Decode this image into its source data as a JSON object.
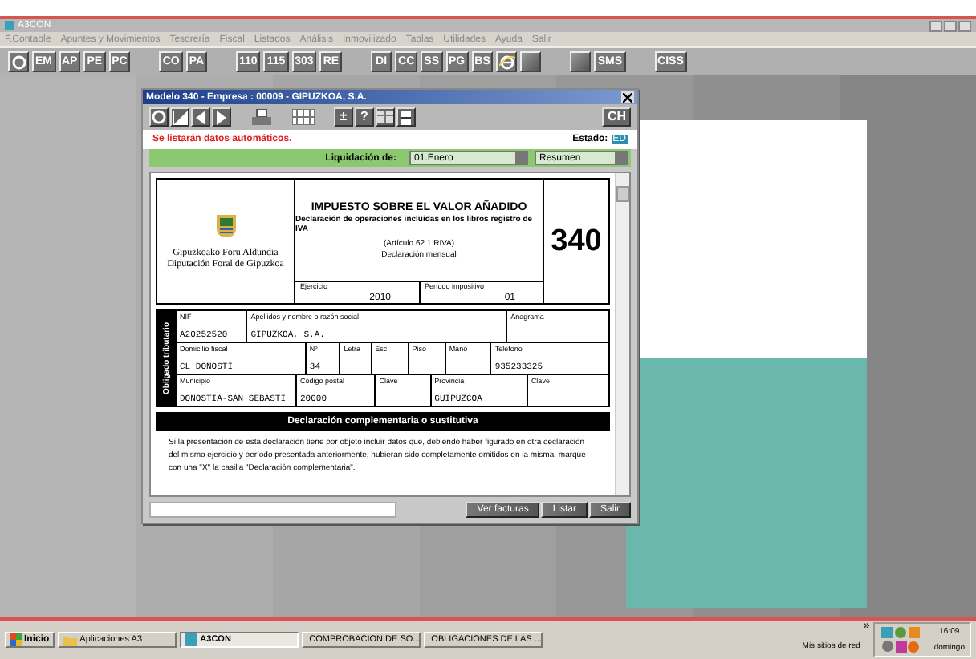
{
  "app": {
    "title": "A3CON",
    "menu": [
      "F.Contable",
      "Apuntes y Movimientos",
      "Tesorería",
      "Fiscal",
      "Listados",
      "Análisis",
      "Inmovilizado",
      "Tablas",
      "Utilidades",
      "Ayuda",
      "Salir"
    ],
    "toolbar": [
      {
        "kind": "refresh"
      },
      {
        "kind": "text",
        "label": "EM"
      },
      {
        "kind": "text",
        "label": "AP"
      },
      {
        "kind": "text",
        "label": "PE"
      },
      {
        "kind": "text",
        "label": "PC"
      },
      {
        "kind": "gap"
      },
      {
        "kind": "text",
        "label": "CO"
      },
      {
        "kind": "text",
        "label": "PA"
      },
      {
        "kind": "gap"
      },
      {
        "kind": "text",
        "label": "110"
      },
      {
        "kind": "text",
        "label": "115"
      },
      {
        "kind": "text",
        "label": "303"
      },
      {
        "kind": "text",
        "label": "RE"
      },
      {
        "kind": "gap"
      },
      {
        "kind": "text",
        "label": "DI"
      },
      {
        "kind": "text",
        "label": "CC"
      },
      {
        "kind": "text",
        "label": "SS"
      },
      {
        "kind": "text",
        "label": "PG"
      },
      {
        "kind": "text",
        "label": "BS"
      },
      {
        "kind": "globe"
      },
      {
        "kind": "blank"
      },
      {
        "kind": "gap"
      },
      {
        "kind": "blank"
      },
      {
        "kind": "text",
        "label": "SMS"
      },
      {
        "kind": "gap"
      },
      {
        "kind": "text",
        "label": "CISS"
      }
    ]
  },
  "dialog": {
    "title": "Modelo 340 - Empresa : 00009 - GIPUZKOA, S.A.",
    "toolbar": [
      {
        "kind": "refresh"
      },
      {
        "kind": "square"
      },
      {
        "kind": "left"
      },
      {
        "kind": "right"
      },
      {
        "kind": "gap"
      },
      {
        "kind": "print"
      },
      {
        "kind": "gap"
      },
      {
        "kind": "grid"
      },
      {
        "kind": "gap"
      },
      {
        "kind": "text",
        "label": "±"
      },
      {
        "kind": "text",
        "label": "?"
      },
      {
        "kind": "table"
      },
      {
        "kind": "minus"
      }
    ],
    "ch_button": "CH",
    "message": "Se listarán datos automáticos.",
    "estado_label": "Estado:",
    "estado_value": "ED",
    "liquidacion_label": "Liquidación de:",
    "period": "01.Enero",
    "view": "Resumen",
    "form": {
      "org_line_1": "Gipuzkoako Foru Aldundia",
      "org_line_2": "Diputación Foral de Gipuzkoa",
      "heading": "IMPUESTO SOBRE EL VALOR AÑADIDO",
      "subheading": "Declaración de operaciones incluidas en los libros registro de IVA",
      "note_1": "(Artículo 62.1 RIVA)",
      "note_2": "Declaración mensual",
      "model_number": "340",
      "period_fields": [
        {
          "label": "Ejercicio",
          "value": "2010"
        },
        {
          "label": "Período impositivo",
          "value": "01"
        }
      ],
      "section_label": "Obligado tributario",
      "rows": [
        {
          "fields": [
            {
              "label": "NIF",
              "value": "A20252520"
            },
            {
              "label": "Apellidos y nombre o razón social",
              "value": "GIPUZKOA, S.A."
            },
            {
              "label": "Anagrama"
            }
          ]
        },
        {
          "fields": [
            {
              "label": "Domicilio fiscal",
              "value": "CL DONOSTI"
            },
            {
              "label": "Nº",
              "value": "34"
            },
            {
              "label": "Letra"
            },
            {
              "label": "Esc."
            },
            {
              "label": "Piso"
            },
            {
              "label": "Mano"
            },
            {
              "label": "Teléfono",
              "value": "935233325"
            }
          ]
        },
        {
          "fields": [
            {
              "label": "Municipio",
              "value": "DONOSTIA-SAN SEBASTI"
            },
            {
              "label": "Código postal",
              "value": "20000"
            },
            {
              "label": "Clave"
            },
            {
              "label": "Provincia",
              "value": "GUIPUZCOA"
            },
            {
              "label": "Clave"
            }
          ]
        }
      ],
      "banner": "Declaración complementaria o sustitutiva",
      "paragraph": "Si la presentación de esta declaración tiene por objeto incluir datos que, debiendo haber figurado en otra declaración del mismo ejercicio y período presentada anteriormente, hubieran sido completamente omitidos en la misma, marque con una \"X\" la casilla \"Declaración complementaria\"."
    },
    "buttons": [
      "Ver facturas",
      "Listar",
      "Salir"
    ]
  },
  "taskbar": {
    "start": "Inicio",
    "items": [
      {
        "label": "Aplicaciones A3",
        "kind": "folder",
        "selected": false
      },
      {
        "label": "A3CON",
        "kind": "app",
        "selected": true
      },
      {
        "label": "COMPROBACION DE SO...",
        "kind": "doc",
        "selected": false
      },
      {
        "label": "OBLIGACIONES DE LAS ...",
        "kind": "doc",
        "selected": false
      }
    ],
    "network": "Mis sitios de red",
    "chevron": "»",
    "time": "16:09",
    "day": "domingo"
  }
}
